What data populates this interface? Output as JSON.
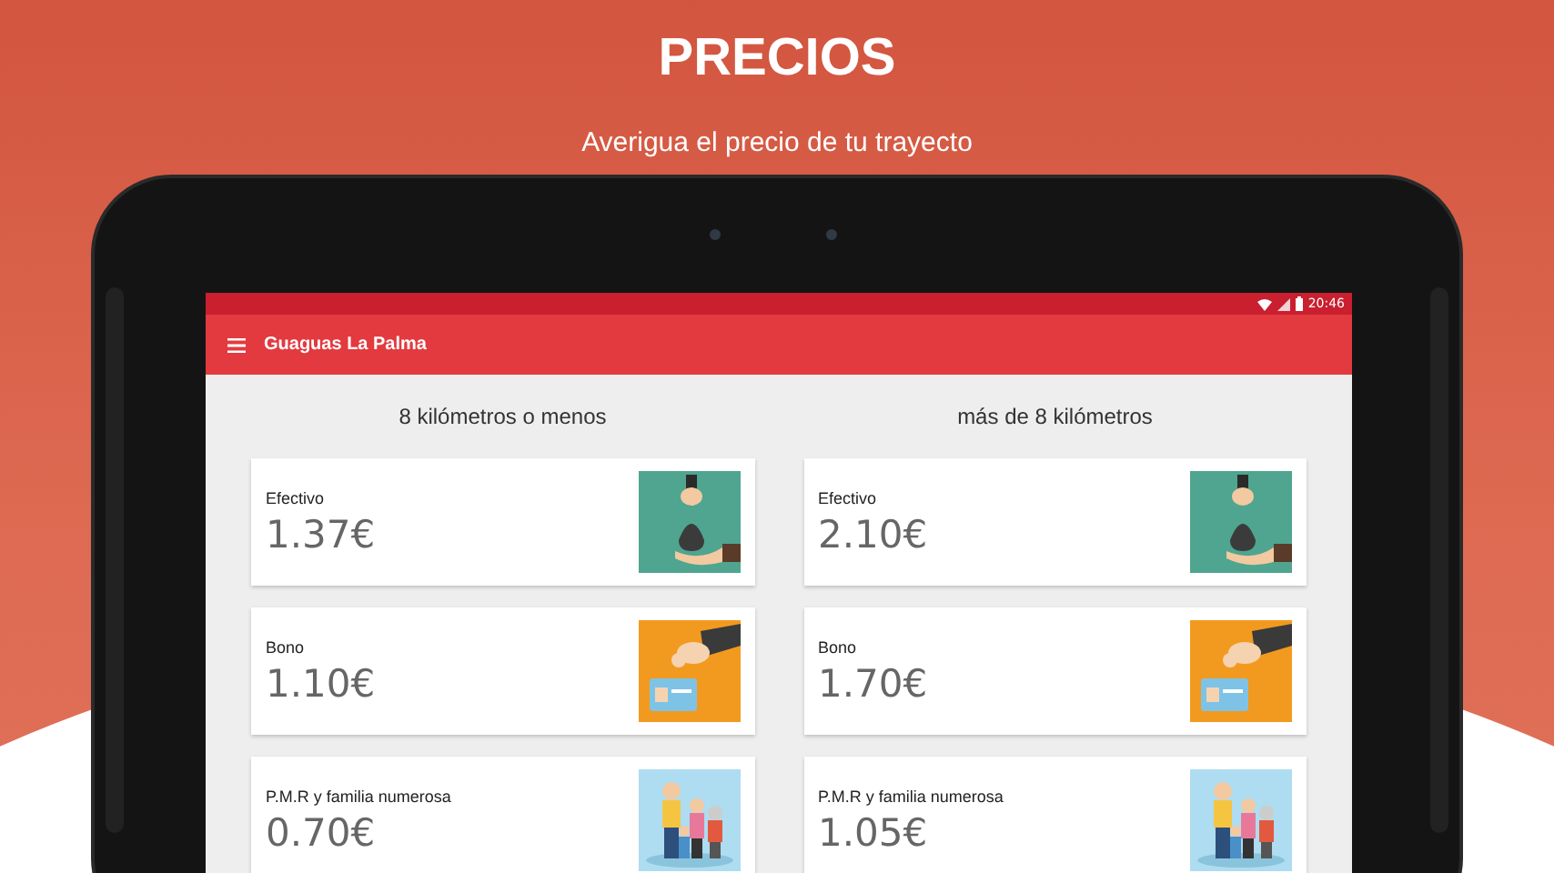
{
  "header": {
    "title": "PRECIOS",
    "subtitle": "Averigua el precio de tu trayecto"
  },
  "status_bar": {
    "time": "20:46"
  },
  "app_bar": {
    "title": "Guaguas La Palma"
  },
  "columns": [
    {
      "heading": "8 kilómetros o menos",
      "fares": [
        {
          "kind": "cash",
          "label": "Efectivo",
          "price": "1.37€"
        },
        {
          "kind": "ticket",
          "label": "Bono",
          "price": "1.10€"
        },
        {
          "kind": "family",
          "label": "P.M.R y familia numerosa",
          "price": "0.70€"
        }
      ]
    },
    {
      "heading": "más de 8 kilómetros",
      "fares": [
        {
          "kind": "cash",
          "label": "Efectivo",
          "price": "2.10€"
        },
        {
          "kind": "ticket",
          "label": "Bono",
          "price": "1.70€"
        },
        {
          "kind": "family",
          "label": "P.M.R y familia numerosa",
          "price": "1.05€"
        }
      ]
    }
  ]
}
